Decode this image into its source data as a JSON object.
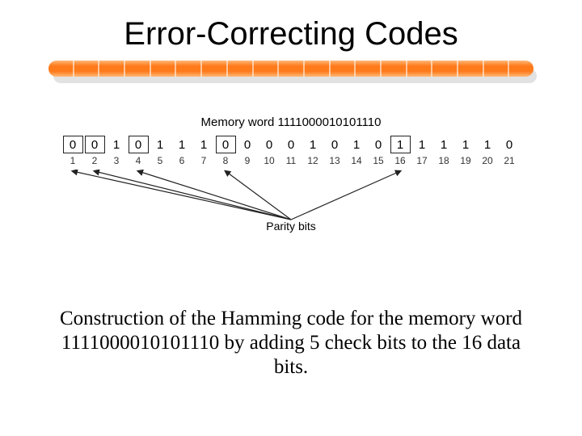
{
  "title": "Error-Correcting Codes",
  "figure": {
    "memory_label": "Memory word 1111000010101110",
    "parity_label": "Parity bits",
    "bits": [
      {
        "pos": 1,
        "val": "0",
        "parity": true
      },
      {
        "pos": 2,
        "val": "0",
        "parity": true
      },
      {
        "pos": 3,
        "val": "1",
        "parity": false
      },
      {
        "pos": 4,
        "val": "0",
        "parity": true
      },
      {
        "pos": 5,
        "val": "1",
        "parity": false
      },
      {
        "pos": 6,
        "val": "1",
        "parity": false
      },
      {
        "pos": 7,
        "val": "1",
        "parity": false
      },
      {
        "pos": 8,
        "val": "0",
        "parity": true
      },
      {
        "pos": 9,
        "val": "0",
        "parity": false
      },
      {
        "pos": 10,
        "val": "0",
        "parity": false
      },
      {
        "pos": 11,
        "val": "0",
        "parity": false
      },
      {
        "pos": 12,
        "val": "1",
        "parity": false
      },
      {
        "pos": 13,
        "val": "0",
        "parity": false
      },
      {
        "pos": 14,
        "val": "1",
        "parity": false
      },
      {
        "pos": 15,
        "val": "0",
        "parity": false
      },
      {
        "pos": 16,
        "val": "1",
        "parity": true
      },
      {
        "pos": 17,
        "val": "1",
        "parity": false
      },
      {
        "pos": 18,
        "val": "1",
        "parity": false
      },
      {
        "pos": 19,
        "val": "1",
        "parity": false
      },
      {
        "pos": 20,
        "val": "1",
        "parity": false
      },
      {
        "pos": 21,
        "val": "0",
        "parity": false
      }
    ]
  },
  "caption": "Construction of the Hamming code for the memory word 1111000010101110 by adding 5 check bits to the 16 data bits.",
  "colors": {
    "accent": "#ff7a1a"
  }
}
